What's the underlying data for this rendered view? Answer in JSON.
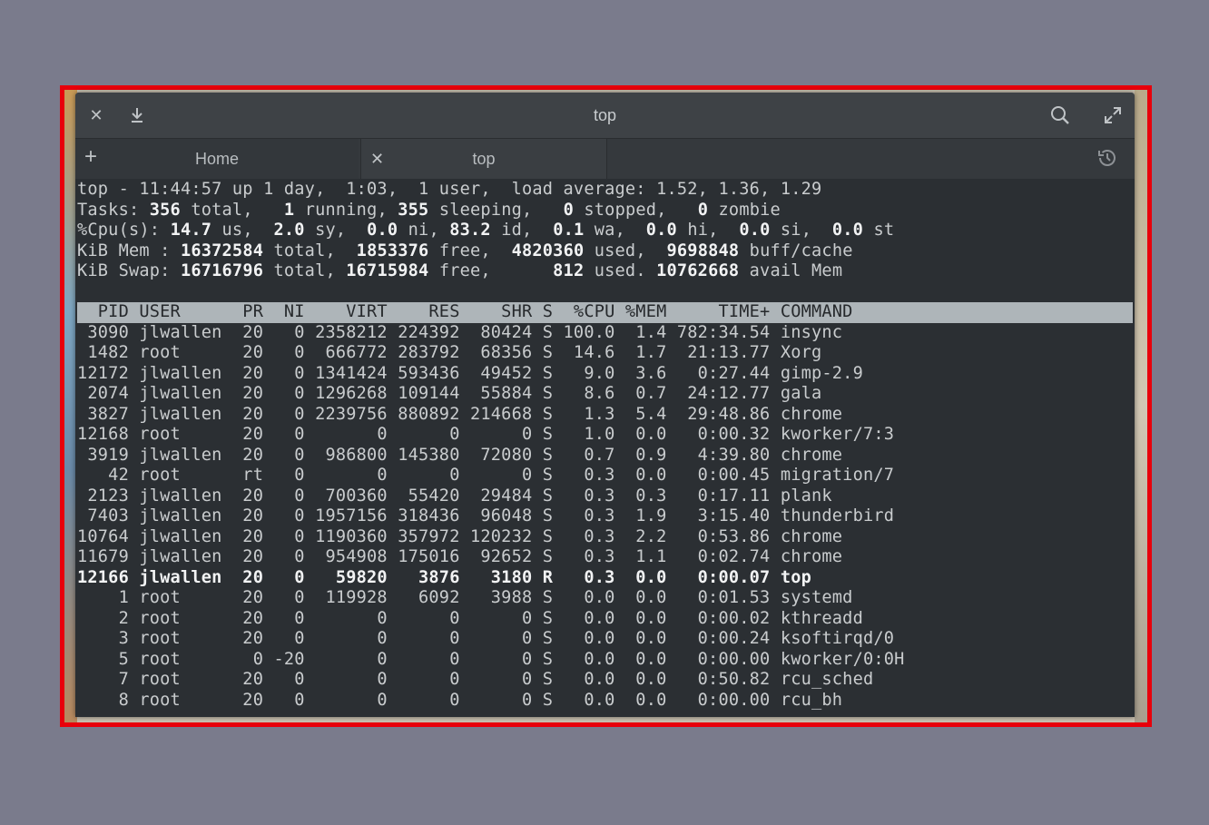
{
  "window": {
    "title": "top",
    "tabs": [
      {
        "label": "Home"
      },
      {
        "label": "top"
      }
    ]
  },
  "summary": {
    "line1": "top - 11:44:57 up 1 day,  1:03,  1 user,  load average: 1.52, 1.36, 1.29",
    "tasks": {
      "pre": "Tasks: ",
      "total": "356",
      "t1": " total,   ",
      "running": "1",
      "t2": " running, ",
      "sleeping": "355",
      "t3": " sleeping,   ",
      "stopped": "0",
      "t4": " stopped,   ",
      "zombie": "0",
      "t5": " zombie"
    },
    "cpu": {
      "pre": "%Cpu(s): ",
      "us": "14.7",
      "t1": " us,  ",
      "sy": "2.0",
      "t2": " sy,  ",
      "ni": "0.0",
      "t3": " ni, ",
      "id": "83.2",
      "t4": " id,  ",
      "wa": "0.1",
      "t5": " wa,  ",
      "hi": "0.0",
      "t6": " hi,  ",
      "si": "0.0",
      "t7": " si,  ",
      "st": "0.0",
      "t8": " st"
    },
    "mem": {
      "pre": "KiB Mem : ",
      "total": "16372584",
      "t1": " total,  ",
      "free": "1853376",
      "t2": " free,  ",
      "used": "4820360",
      "t3": " used,  ",
      "buff": "9698848",
      "t4": " buff/cache"
    },
    "swap": {
      "pre": "KiB Swap: ",
      "total": "16716796",
      "t1": " total, ",
      "free": "16715984",
      "t2": " free,      ",
      "used": "812",
      "t3": " used. ",
      "avail": "10762668",
      "t4": " avail Mem"
    }
  },
  "table": {
    "header": "  PID USER      PR  NI    VIRT    RES    SHR S  %CPU %MEM     TIME+ COMMAND",
    "rows": [
      " 3090 jlwallen  20   0 2358212 224392  80424 S 100.0  1.4 782:34.54 insync",
      " 1482 root      20   0  666772 283792  68356 S  14.6  1.7  21:13.77 Xorg",
      "12172 jlwallen  20   0 1341424 593436  49452 S   9.0  3.6   0:27.44 gimp-2.9",
      " 2074 jlwallen  20   0 1296268 109144  55884 S   8.6  0.7  24:12.77 gala",
      " 3827 jlwallen  20   0 2239756 880892 214668 S   1.3  5.4  29:48.86 chrome",
      "12168 root      20   0       0      0      0 S   1.0  0.0   0:00.32 kworker/7:3",
      " 3919 jlwallen  20   0  986800 145380  72080 S   0.7  0.9   4:39.80 chrome",
      "   42 root      rt   0       0      0      0 S   0.3  0.0   0:00.45 migration/7",
      " 2123 jlwallen  20   0  700360  55420  29484 S   0.3  0.3   0:17.11 plank",
      " 7403 jlwallen  20   0 1957156 318436  96048 S   0.3  1.9   3:15.40 thunderbird",
      "10764 jlwallen  20   0 1190360 357972 120232 S   0.3  2.2   0:53.86 chrome",
      "11679 jlwallen  20   0  954908 175016  92652 S   0.3  1.1   0:02.74 chrome",
      "12166 jlwallen  20   0   59820   3876   3180 R   0.3  0.0   0:00.07 top",
      "    1 root      20   0  119928   6092   3988 S   0.0  0.0   0:01.53 systemd",
      "    2 root      20   0       0      0      0 S   0.0  0.0   0:00.02 kthreadd",
      "    3 root      20   0       0      0      0 S   0.0  0.0   0:00.24 ksoftirqd/0",
      "    5 root       0 -20       0      0      0 S   0.0  0.0   0:00.00 kworker/0:0H",
      "    7 root      20   0       0      0      0 S   0.0  0.0   0:50.82 rcu_sched",
      "    8 root      20   0       0      0      0 S   0.0  0.0   0:00.00 rcu_bh"
    ]
  }
}
